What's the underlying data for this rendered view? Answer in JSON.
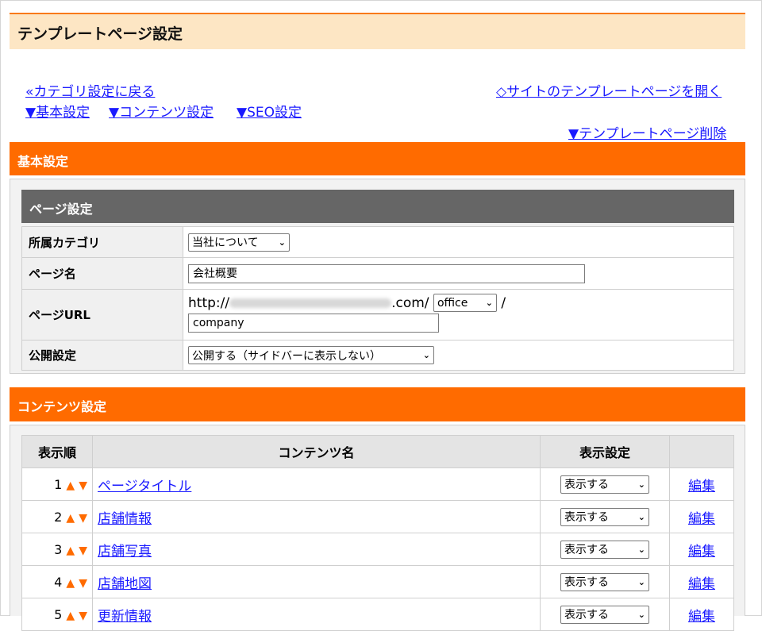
{
  "page": {
    "title": "テンプレートページ設定"
  },
  "nav": {
    "back": "«カテゴリ設定に戻る",
    "open_site": "◇サイトのテンプレートページを開く",
    "basic": "▼基本設定",
    "content": "▼コンテンツ設定",
    "seo": "▼SEO設定",
    "delete": "▼テンプレートページ削除"
  },
  "basic_section": {
    "title": "基本設定",
    "subheader": "ページ設定",
    "fields": {
      "category_label": "所属カテゴリ",
      "category_value": "当社について",
      "page_name_label": "ページ名",
      "page_name_value": "会社概要",
      "url_label": "ページURL",
      "url_prefix": "http://",
      "url_domain_suffix": ".com/",
      "url_dir_value": "office",
      "url_slash": "/",
      "url_slug_value": "company",
      "publish_label": "公開設定",
      "publish_value": "公開する（サイドバーに表示しない）"
    }
  },
  "content_section": {
    "title": "コンテンツ設定",
    "headers": {
      "order": "表示順",
      "name": "コンテンツ名",
      "display": "表示設定",
      "edit": ""
    },
    "rows": [
      {
        "order": "1",
        "name": "ページタイトル",
        "display": "表示する",
        "edit": "編集"
      },
      {
        "order": "2",
        "name": "店舗情報",
        "display": "表示する",
        "edit": "編集"
      },
      {
        "order": "3",
        "name": "店舗写真",
        "display": "表示する",
        "edit": "編集"
      },
      {
        "order": "4",
        "name": "店舗地図",
        "display": "表示する",
        "edit": "編集"
      },
      {
        "order": "5",
        "name": "更新情報",
        "display": "表示する",
        "edit": "編集"
      }
    ]
  },
  "icons": {
    "up": "▲",
    "down": "▼",
    "chevron": "⌄"
  },
  "colors": {
    "accent": "#ff6b00",
    "header_bg": "#fde6c4",
    "subheader_bg": "#666666",
    "link": "#1a1aff"
  }
}
